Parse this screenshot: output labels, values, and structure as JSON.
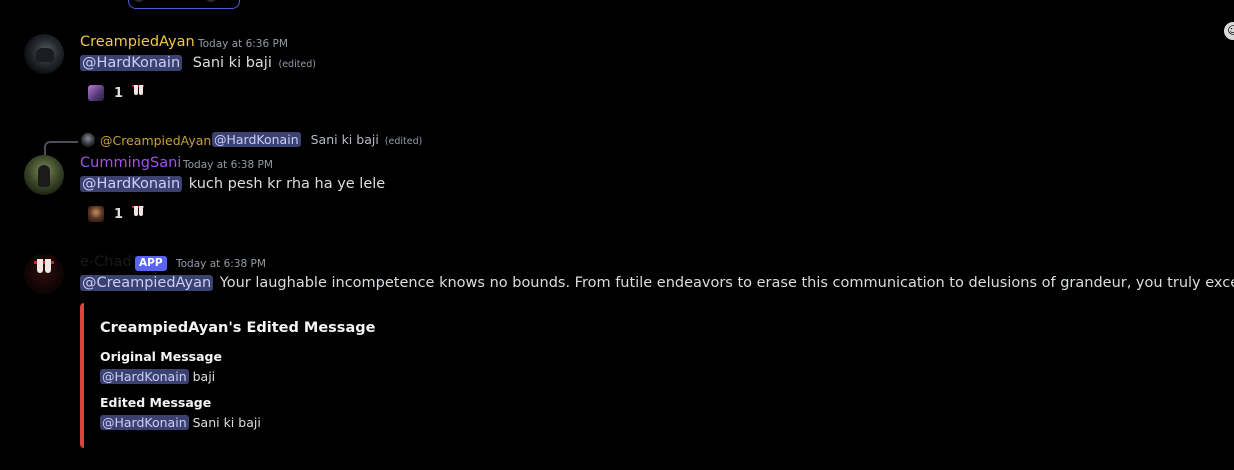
{
  "messages": [
    {
      "author": "CreampiedAyan",
      "author_color": "#f0c93f",
      "timestamp": "Today at 6:36 PM",
      "mention": "@HardKonain",
      "text": "Sani ki baji",
      "edited": "(edited)",
      "reaction_count": "1"
    },
    {
      "reply": {
        "author": "@CreampiedAyan",
        "mention": "@HardKonain",
        "text": "Sani ki baji",
        "edited": "(edited)"
      },
      "author": "CummingSani",
      "author_color": "#a052f2",
      "timestamp": "Today at 6:38 PM",
      "mention": "@HardKonain",
      "text": "kuch pesh kr rha ha ye lele",
      "reaction_count": "1"
    },
    {
      "author": "e-Chad",
      "author_color": "#1a1a1a",
      "badge": "APP",
      "timestamp": "Today at 6:38 PM",
      "mention": "@CreampiedAyan",
      "text": "Your laughable incompetence knows no bounds. From futile endeavors to erase this communication to delusions of grandeur, you truly excel.",
      "embed": {
        "title": "CreampiedAyan's Edited Message",
        "accent_color": "#e0423c",
        "fields": [
          {
            "name": "Original Message",
            "mention": "@HardKonain",
            "value": "baji"
          },
          {
            "name": "Edited Message",
            "mention": "@HardKonain",
            "value": "Sani ki baji"
          }
        ]
      }
    }
  ]
}
